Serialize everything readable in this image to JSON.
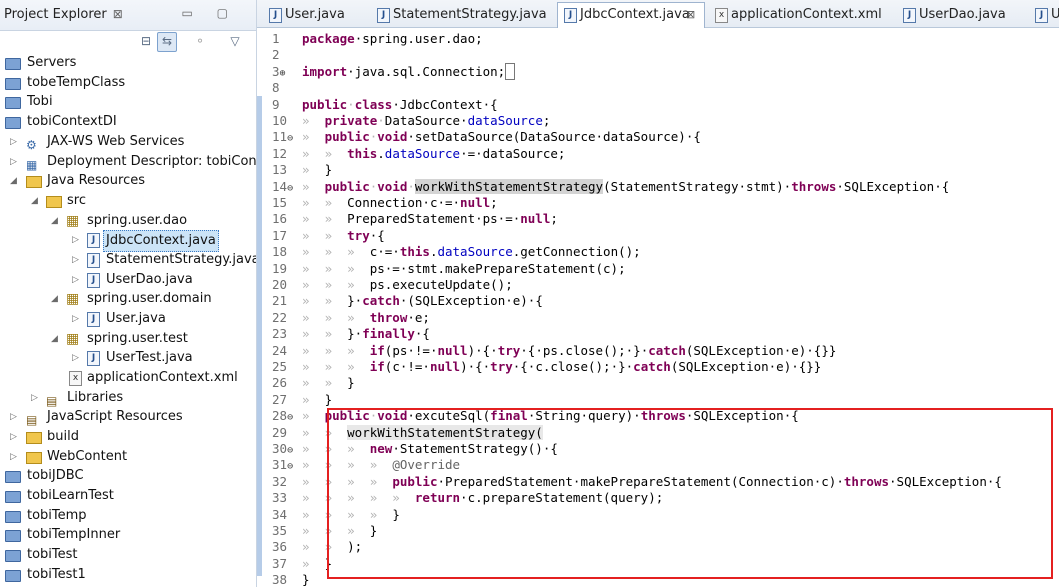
{
  "explorer": {
    "title": "Project Explorer",
    "close_glyph": "⊠",
    "controls": "▭ ▢",
    "tree": [
      {
        "label": "Servers"
      },
      {
        "label": "tobeTempClass"
      },
      {
        "label": "Tobi"
      },
      {
        "label": "tobiContextDI"
      },
      {
        "label": "JAX-WS Web Services"
      },
      {
        "label": "Deployment Descriptor: tobiConte"
      },
      {
        "label": "Java Resources"
      },
      {
        "label": "src"
      },
      {
        "label": "spring.user.dao"
      },
      {
        "label": "JdbcContext.java"
      },
      {
        "label": "StatementStrategy.java"
      },
      {
        "label": "UserDao.java"
      },
      {
        "label": "spring.user.domain"
      },
      {
        "label": "User.java"
      },
      {
        "label": "spring.user.test"
      },
      {
        "label": "UserTest.java"
      },
      {
        "label": "applicationContext.xml"
      },
      {
        "label": "Libraries"
      },
      {
        "label": "JavaScript Resources"
      },
      {
        "label": "build"
      },
      {
        "label": "WebContent"
      },
      {
        "label": "tobiJDBC"
      },
      {
        "label": "tobiLearnTest"
      },
      {
        "label": "tobiTemp"
      },
      {
        "label": "tobiTempInner"
      },
      {
        "label": "tobiTest"
      },
      {
        "label": "tobiTest1"
      }
    ]
  },
  "editor": {
    "tabs": [
      {
        "label": "User.java",
        "icon": "J"
      },
      {
        "label": "StatementStrategy.java",
        "icon": "J"
      },
      {
        "label": "JdbcContext.java",
        "icon": "J",
        "close": "⊠"
      },
      {
        "label": "applicationContext.xml",
        "icon": "x"
      },
      {
        "label": "UserDao.java",
        "icon": "J"
      },
      {
        "label": "U",
        "icon": "J"
      }
    ],
    "lines": [
      {
        "n": "1",
        "fold": ""
      },
      {
        "n": "2",
        "fold": ""
      },
      {
        "n": "3",
        "fold": "⊕"
      },
      {
        "n": "8",
        "fold": ""
      },
      {
        "n": "9",
        "fold": ""
      },
      {
        "n": "10",
        "fold": ""
      },
      {
        "n": "11",
        "fold": "⊖"
      },
      {
        "n": "12",
        "fold": ""
      },
      {
        "n": "13",
        "fold": ""
      },
      {
        "n": "14",
        "fold": "⊖"
      },
      {
        "n": "15",
        "fold": ""
      },
      {
        "n": "16",
        "fold": ""
      },
      {
        "n": "17",
        "fold": ""
      },
      {
        "n": "18",
        "fold": ""
      },
      {
        "n": "19",
        "fold": ""
      },
      {
        "n": "20",
        "fold": ""
      },
      {
        "n": "21",
        "fold": ""
      },
      {
        "n": "22",
        "fold": ""
      },
      {
        "n": "23",
        "fold": ""
      },
      {
        "n": "24",
        "fold": ""
      },
      {
        "n": "25",
        "fold": ""
      },
      {
        "n": "26",
        "fold": ""
      },
      {
        "n": "27",
        "fold": ""
      },
      {
        "n": "28",
        "fold": "⊖"
      },
      {
        "n": "29",
        "fold": ""
      },
      {
        "n": "30",
        "fold": "⊖"
      },
      {
        "n": "31",
        "fold": "⊖"
      },
      {
        "n": "32",
        "fold": ""
      },
      {
        "n": "33",
        "fold": ""
      },
      {
        "n": "34",
        "fold": ""
      },
      {
        "n": "35",
        "fold": ""
      },
      {
        "n": "36",
        "fold": ""
      },
      {
        "n": "37",
        "fold": ""
      },
      {
        "n": "38",
        "fold": ""
      }
    ],
    "code": {
      "l1_pkg": "package",
      "l1_rest": "·spring.user.dao;",
      "l3_kw": "import",
      "l3_rest": "·java.sql.Connection;",
      "l3_box": "□",
      "l9": [
        "public",
        "class",
        "·JdbcContext·{"
      ],
      "l10": [
        "private",
        "DataSource·",
        "dataSource",
        ";"
      ],
      "l11": [
        "public",
        "void",
        "·setDataSource(DataSource·dataSource)·{"
      ],
      "l12": [
        "this",
        "dataSource",
        "·=·dataSource;"
      ],
      "l13": "}",
      "l14": [
        "public",
        "void",
        "workWithStatementStrategy",
        "(StatementStrategy·stmt)·",
        "throws",
        "·SQLException·{"
      ],
      "l15": [
        "Connection·c·=·",
        "null",
        ";"
      ],
      "l16": [
        "PreparedStatement·ps·=·",
        "null",
        ";"
      ],
      "l17": [
        "try",
        "·{"
      ],
      "l18": [
        "c·=·",
        "this",
        "dataSource",
        ".getConnection();"
      ],
      "l19": "ps·=·stmt.makePrepareStatement(c);",
      "l20": "ps.executeUpdate();",
      "l21": [
        "}·",
        "catch",
        "·(SQLException·e)·{"
      ],
      "l22": [
        "throw",
        "·e;"
      ],
      "l23": [
        "}·",
        "finally",
        "·{"
      ],
      "l24": [
        "if",
        "(ps·!=·",
        "null",
        ")·{·",
        "try",
        "·{·ps.close();·}·",
        "catch",
        "(SQLException·e)·{}}"
      ],
      "l25": [
        "if",
        "(c·!=·",
        "null",
        ")·{·",
        "try",
        "·{·c.close();·}·",
        "catch",
        "(SQLException·e)·{}}"
      ],
      "l26": "}",
      "l27": "}",
      "l28": [
        "public",
        "void",
        "·excuteSql(",
        "final",
        "·String·query)·",
        "throws",
        "·SQLException·{"
      ],
      "l29": "workWithStatementStrategy(",
      "l30": [
        "new",
        "·StatementStrategy()·{"
      ],
      "l31": "@Override",
      "l32": [
        "public",
        "·PreparedStatement·makePrepareStatement(Connection·c)·",
        "throws",
        "·SQLException·{"
      ],
      "l33": [
        "return",
        "·c.prepareStatement(query);"
      ],
      "l34": "}",
      "l35": "}",
      "l36": ");",
      "l37": "}",
      "l38": "}"
    }
  },
  "colors": {
    "keyword": "#7f0055",
    "field": "#0000c0",
    "highlight_box": "#e42020"
  }
}
